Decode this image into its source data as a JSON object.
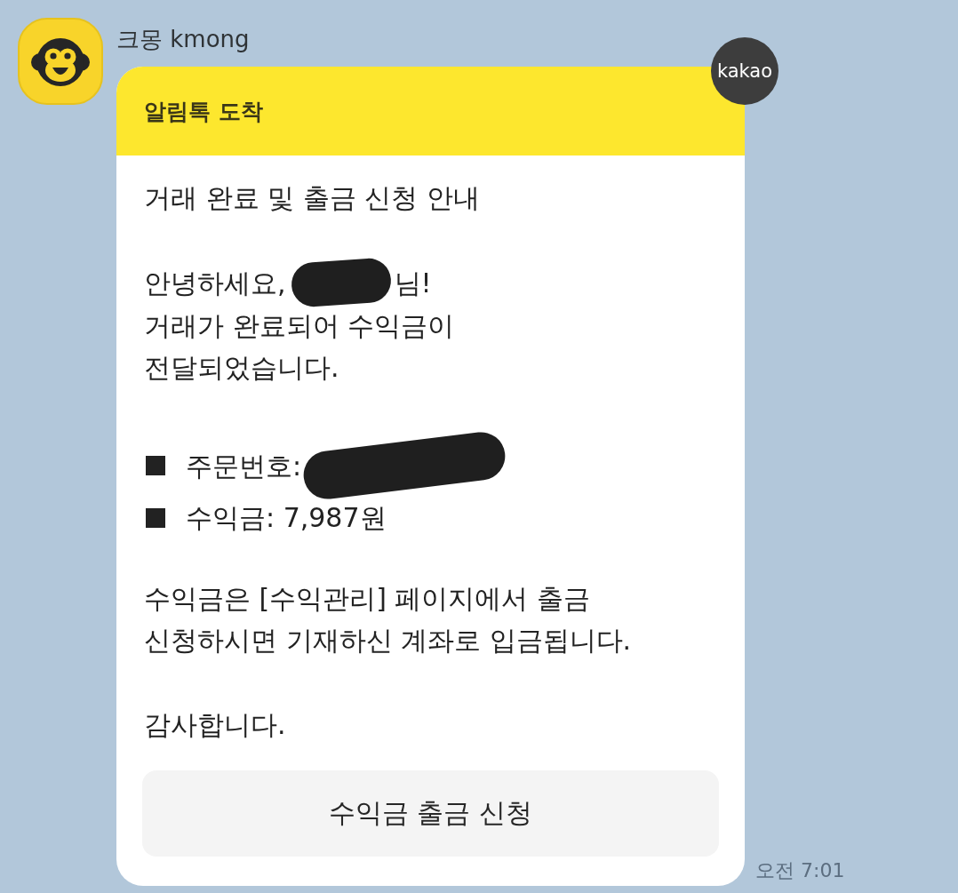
{
  "sender": {
    "name": "크몽 kmong"
  },
  "message": {
    "header": "알림톡 도착",
    "badge": "kakao",
    "heading": "거래 완료 및 출금 신청 안내",
    "greeting": {
      "before": "안녕하세요,",
      "redacted": true,
      "after": "님!"
    },
    "intro": "거래가 완료되어 수익금이\n전달되었습니다.",
    "details": [
      {
        "text": "주문번호:",
        "redacted": true
      },
      {
        "text": "수익금: 7,987원",
        "redacted": false
      }
    ],
    "note": "수익금은 [수익관리] 페이지에서 출금\n신청하시면 기재하신 계좌로 입금됩니다.",
    "closing": "감사합니다.",
    "button": "수익금 출금 신청"
  },
  "timestamp": "오전 7:01"
}
